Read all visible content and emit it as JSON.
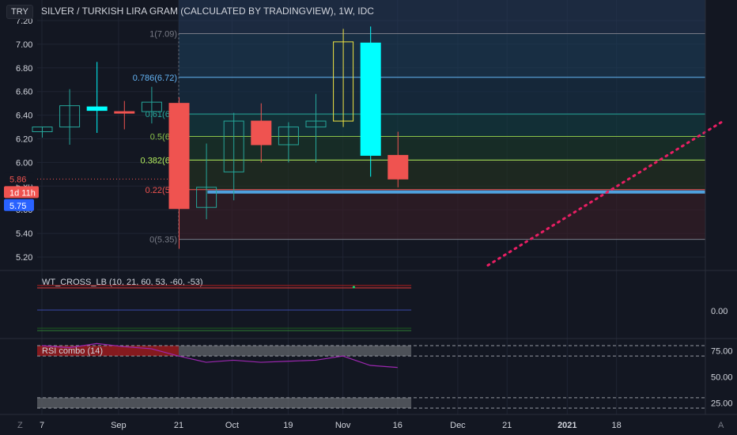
{
  "header": {
    "currency_button": "TRY",
    "title": "SILVER / TURKISH LIRA GRAM (CALCULATED BY TRADINGVIEW), 1W, IDC"
  },
  "colors": {
    "background": "#131722",
    "up": "#26a69a",
    "down": "#ef5350",
    "cyan_candle": "#00ffff",
    "yellow_candle": "#f0e442",
    "trendline": "#e91e63",
    "hline": "#4fa3e0"
  },
  "price_axis": {
    "ticks": [
      "7.20",
      "7.00",
      "6.80",
      "6.60",
      "6.40",
      "6.20",
      "6.00",
      "5.80",
      "5.60",
      "5.40",
      "5.20"
    ],
    "tick_values": [
      7.2,
      7.0,
      6.8,
      6.6,
      6.4,
      6.2,
      6.0,
      5.8,
      5.6,
      5.4,
      5.2
    ],
    "badges": [
      {
        "label": "5.86",
        "value": 5.86,
        "type": "last"
      },
      {
        "label": "1d 11h",
        "value": 5.78,
        "type": "countdown"
      },
      {
        "label": "5.75",
        "value": 5.75,
        "type": "line"
      }
    ]
  },
  "time_axis": {
    "labels": [
      "7",
      "Sep",
      "21",
      "Oct",
      "19",
      "Nov",
      "16",
      "Dec",
      "21",
      "2021",
      "18"
    ],
    "label_week_index": [
      0,
      2.8,
      5,
      6.95,
      9,
      11,
      13,
      15.2,
      17,
      19.2,
      21
    ],
    "corner_left": "Z",
    "corner_right": "A"
  },
  "chart_data": [
    {
      "type": "candlestick",
      "title": "SILVER / TURKISH LIRA GRAM (CALCULATED BY TRADINGVIEW), 1W, IDC",
      "ylim": [
        5.15,
        7.25
      ],
      "candles": [
        {
          "o": 6.26,
          "h": 6.3,
          "l": 6.21,
          "c": 6.3,
          "color": "up"
        },
        {
          "o": 6.3,
          "h": 6.62,
          "l": 6.15,
          "c": 6.48,
          "color": "up"
        },
        {
          "o": 6.47,
          "h": 6.85,
          "l": 6.25,
          "c": 6.44,
          "color": "cyan"
        },
        {
          "o": 6.43,
          "h": 6.52,
          "l": 6.28,
          "c": 6.42,
          "color": "down"
        },
        {
          "o": 6.43,
          "h": 6.64,
          "l": 6.33,
          "c": 6.51,
          "color": "up"
        },
        {
          "o": 6.5,
          "h": 6.55,
          "l": 5.27,
          "c": 5.61,
          "color": "down"
        },
        {
          "o": 5.62,
          "h": 6.16,
          "l": 5.52,
          "c": 5.79,
          "color": "up"
        },
        {
          "o": 5.92,
          "h": 6.42,
          "l": 5.68,
          "c": 6.35,
          "color": "up"
        },
        {
          "o": 6.35,
          "h": 6.5,
          "l": 6.0,
          "c": 6.15,
          "color": "down"
        },
        {
          "o": 6.15,
          "h": 6.34,
          "l": 6.0,
          "c": 6.3,
          "color": "up"
        },
        {
          "o": 6.3,
          "h": 6.58,
          "l": 6.0,
          "c": 6.35,
          "color": "up"
        },
        {
          "o": 6.35,
          "h": 7.13,
          "l": 6.3,
          "c": 7.02,
          "color": "yellow"
        },
        {
          "o": 7.01,
          "h": 7.15,
          "l": 5.88,
          "c": 6.06,
          "color": "cyan"
        },
        {
          "o": 6.06,
          "h": 6.26,
          "l": 5.79,
          "c": 5.86,
          "color": "down"
        }
      ],
      "fib_levels": [
        {
          "ratio": 1,
          "value": 7.09,
          "label": "1(7.09)",
          "color": "#787b86"
        },
        {
          "ratio": 0.786,
          "value": 6.72,
          "label": "0.786(6.72)",
          "color": "#64b5f6"
        },
        {
          "ratio": 0.618,
          "value": 6.41,
          "label": "0.61(6.4",
          "color": "#26a69a"
        },
        {
          "ratio": 0.5,
          "value": 6.22,
          "label": "0.5(6.2",
          "color": "#8bc34a"
        },
        {
          "ratio": 0.382,
          "value": 6.02,
          "label": "0.382(6.0",
          "color": "#b2ec5d"
        },
        {
          "ratio": 0.236,
          "value": 5.77,
          "label": "0.22(5.7",
          "color": "#ef5350"
        },
        {
          "ratio": 0,
          "value": 5.35,
          "label": "0(5.35)",
          "color": "#787b86"
        }
      ],
      "horizontal_line": {
        "value": 5.75,
        "color": "#4fa3e0"
      },
      "trendline": {
        "from": {
          "week": 16.3,
          "value": 5.13
        },
        "to": {
          "week": 24.9,
          "value": 6.35
        },
        "color": "#e91e63",
        "style": "dotted"
      }
    },
    {
      "type": "line",
      "title": "WT_CROSS_LB (10, 21, 60, 53, -60, -53)",
      "axis_ticks": [
        "0.00"
      ],
      "lines": [
        {
          "name": "",
          "color": "#b71c1c",
          "level": 60
        },
        {
          "name": "",
          "color": "#e53935",
          "level": 53
        },
        {
          "name": "",
          "color": "#3949ab",
          "level": 0
        },
        {
          "name": "",
          "color": "#1b5e20",
          "level": -53
        },
        {
          "name": "",
          "color": "#2e7d32",
          "level": -60
        }
      ]
    },
    {
      "type": "line",
      "title": "RSI combo (14)",
      "axis_ticks": [
        "75.00",
        "50.00",
        "25.00"
      ],
      "ylim": [
        20,
        80
      ],
      "rsi_values": [
        80,
        78,
        82,
        79,
        77,
        70,
        64,
        66,
        64,
        65,
        66,
        70,
        61,
        59
      ],
      "bands": [
        {
          "from": 70,
          "to": 80
        },
        {
          "from": 20,
          "to": 30
        }
      ]
    }
  ]
}
